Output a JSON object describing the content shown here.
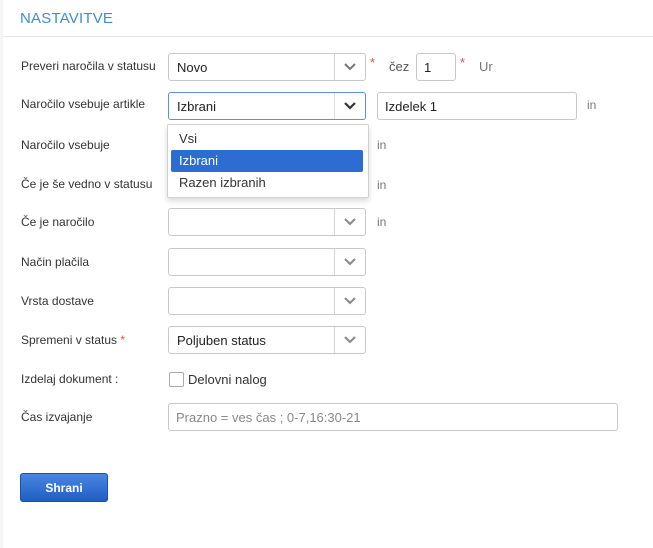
{
  "section_title": "NASTAVITVE",
  "rows": {
    "status_check": {
      "label": "Preveri naročila v statusu",
      "value": "Novo",
      "after_label": "čez",
      "hours_value": "1",
      "unit": "Ur"
    },
    "contains_articles": {
      "label": "Naročilo vsebuje artikle",
      "value": "Izbrani",
      "article_value": "Izdelek 1",
      "suffix": "in"
    },
    "order_contains": {
      "label": "Naročilo vsebuje",
      "suffix": "in"
    },
    "still_in_status": {
      "label": "Če je še vedno v statusu",
      "suffix": "in"
    },
    "if_order": {
      "label": "Če je naročilo",
      "value": "",
      "suffix": "in"
    },
    "payment_method": {
      "label": "Način plačila",
      "value": ""
    },
    "delivery_type": {
      "label": "Vrsta dostave",
      "value": ""
    },
    "change_status": {
      "label": "Spremeni v status",
      "required_mark": "*",
      "value": "Poljuben status"
    },
    "create_document": {
      "label": "Izdelaj dokument :",
      "checkbox_label": "Delovni nalog",
      "checked": false
    },
    "execution_time": {
      "label": "Čas izvajanje",
      "placeholder": "Prazno = ves čas ; 0-7,16:30-21"
    }
  },
  "dropdown": {
    "options": [
      "Vsi",
      "Izbrani",
      "Razen izbranih"
    ],
    "selected": "Izbrani"
  },
  "required_star": "*",
  "save_button": "Shrani",
  "colors": {
    "accent": "#3d8ed3",
    "required": "#d9534f",
    "selected_option": "#2d6cd0",
    "button": "#2d6cd0"
  }
}
